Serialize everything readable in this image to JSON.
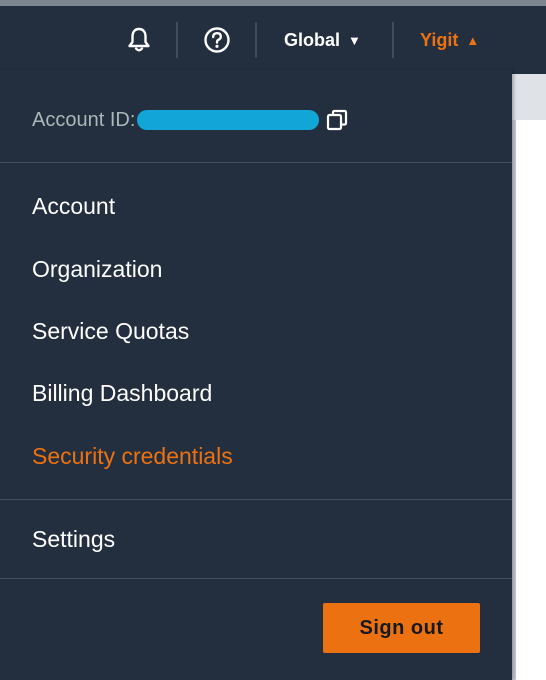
{
  "navbar": {
    "notifications_icon": "bell-icon",
    "help_icon": "question-circle-icon",
    "region_label": "Global",
    "region_caret": "▼",
    "user_label": "Yigit",
    "user_caret": "▲"
  },
  "account": {
    "id_label": "Account ID:",
    "copy_icon": "copy-icon"
  },
  "menu": {
    "items": [
      {
        "label": "Account"
      },
      {
        "label": "Organization"
      },
      {
        "label": "Service Quotas"
      },
      {
        "label": "Billing Dashboard"
      },
      {
        "label": "Security credentials",
        "active": true
      }
    ],
    "settings_label": "Settings",
    "signout_label": "Sign out"
  },
  "colors": {
    "nav_bg": "#232f3e",
    "accent": "#ec7211",
    "redaction": "#12a6d8",
    "divider": "#414d5c"
  }
}
